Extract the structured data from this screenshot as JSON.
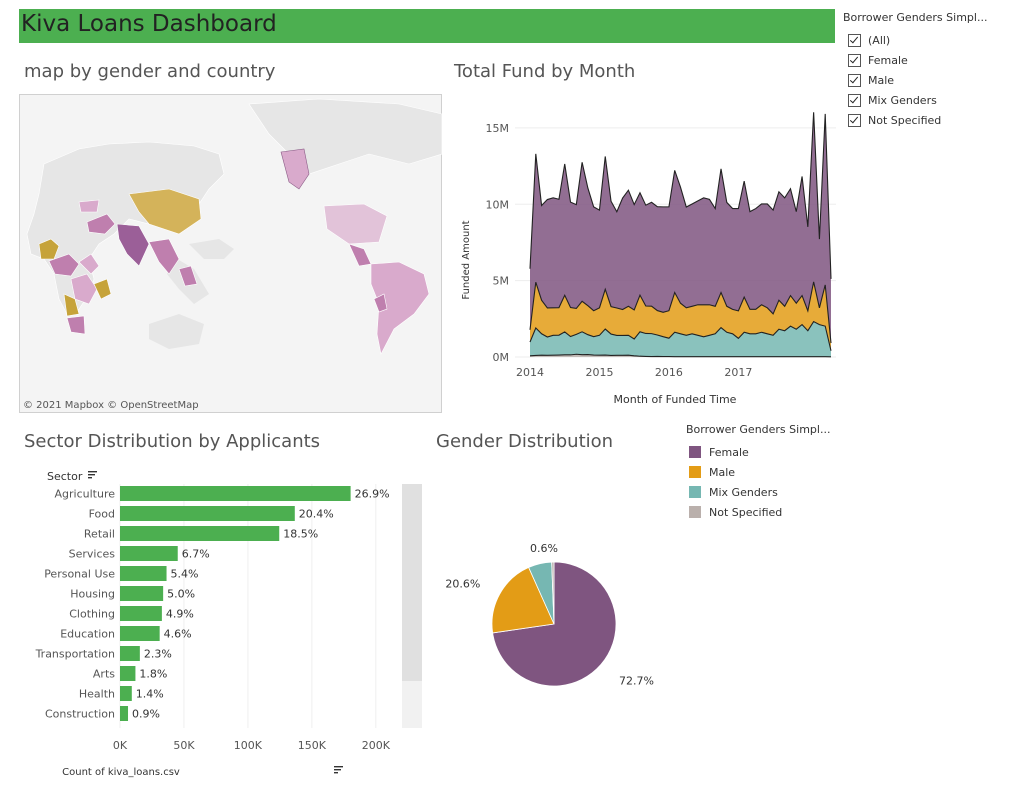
{
  "dashboard": {
    "title": "Kiva Loans Dashboard"
  },
  "colors": {
    "title_bar": "#4caf50",
    "female": "#7f5580",
    "male": "#e39c16",
    "mix": "#76b7b2",
    "not_specified": "#bab0ac",
    "bar": "#4caf50"
  },
  "map": {
    "title": "map by gender and country",
    "attribution": "© 2021 Mapbox  © OpenStreetMap"
  },
  "filter": {
    "title": "Borrower Genders Simpl...",
    "options": [
      "(All)",
      "Female",
      "Male",
      "Mix Genders",
      "Not Specified"
    ]
  },
  "legend": {
    "title": "Borrower Genders Simpl...",
    "items": [
      {
        "label": "Female",
        "color": "#7f5580"
      },
      {
        "label": "Male",
        "color": "#e39c16"
      },
      {
        "label": "Mix Genders",
        "color": "#76b7b2"
      },
      {
        "label": "Not Specified",
        "color": "#bab0ac"
      }
    ]
  },
  "chart_data": [
    {
      "type": "area",
      "title": "Total Fund by Month",
      "xlabel": "Month of Funded Time",
      "ylabel": "Funded Amount",
      "x_ticks": [
        "2014",
        "2015",
        "2016",
        "2017"
      ],
      "y_ticks": [
        "0M",
        "5M",
        "10M",
        "15M"
      ],
      "ylim": [
        0,
        16500000
      ],
      "x_start": "2014-01",
      "stacked": true,
      "series": [
        {
          "name": "Not Specified",
          "values": [
            80000,
            100000,
            120000,
            110000,
            120000,
            130000,
            140000,
            140000,
            180000,
            150000,
            160000,
            130000,
            120000,
            130000,
            100000,
            110000,
            110000,
            120000,
            80000,
            50000,
            40000,
            30000,
            40000,
            30000,
            30000,
            20000,
            20000,
            20000,
            20000,
            20000,
            20000,
            20000,
            20000,
            20000,
            20000,
            20000,
            20000,
            20000,
            20000,
            20000,
            20000,
            20000,
            20000,
            20000,
            20000,
            20000,
            20000,
            20000,
            20000,
            20000,
            20000,
            20000,
            10000
          ]
        },
        {
          "name": "Mix Genders",
          "values": [
            900000,
            1800000,
            1400000,
            1200000,
            1300000,
            1300000,
            1500000,
            1200000,
            1300000,
            1500000,
            1300000,
            1200000,
            1300000,
            1700000,
            1400000,
            1300000,
            1300000,
            1300000,
            1100000,
            1600000,
            1500000,
            1500000,
            1400000,
            1300000,
            1200000,
            1600000,
            1500000,
            1400000,
            1500000,
            1400000,
            1300000,
            1400000,
            1500000,
            1900000,
            1600000,
            1500000,
            1200000,
            1600000,
            1500000,
            1500000,
            1600000,
            1500000,
            1400000,
            1800000,
            1700000,
            2000000,
            1800000,
            2100000,
            1700000,
            2300000,
            2100000,
            2000000,
            400000
          ]
        },
        {
          "name": "Male",
          "values": [
            800000,
            3000000,
            2200000,
            1900000,
            1800000,
            1800000,
            2400000,
            1900000,
            1700000,
            2000000,
            1900000,
            1700000,
            1800000,
            2600000,
            1800000,
            1800000,
            1700000,
            1900000,
            1900000,
            2400000,
            1800000,
            1800000,
            1600000,
            1600000,
            1800000,
            2600000,
            2000000,
            1800000,
            1800000,
            2000000,
            2100000,
            2000000,
            1800000,
            2300000,
            1700000,
            1600000,
            1800000,
            2300000,
            1600000,
            1600000,
            1800000,
            1700000,
            1400000,
            1900000,
            1600000,
            2000000,
            1700000,
            1900000,
            1300000,
            2600000,
            1100000,
            2700000,
            500000
          ]
        },
        {
          "name": "Female",
          "values": [
            4000000,
            8400000,
            6200000,
            7100000,
            7200000,
            7100000,
            8600000,
            6900000,
            6800000,
            9100000,
            7700000,
            6800000,
            6400000,
            8700000,
            6900000,
            6300000,
            7300000,
            7600000,
            6900000,
            6700000,
            6600000,
            6800000,
            6800000,
            6900000,
            6800000,
            8000000,
            7600000,
            6600000,
            6700000,
            6800000,
            7000000,
            6900000,
            6400000,
            8100000,
            6800000,
            6600000,
            6700000,
            7600000,
            6400000,
            6600000,
            6600000,
            6800000,
            6800000,
            7100000,
            7100000,
            7000000,
            6000000,
            7800000,
            5500000,
            11100000,
            4500000,
            11200000,
            4200000
          ]
        }
      ]
    },
    {
      "type": "bar",
      "title": "Sector Distribution by Applicants",
      "category_header": "Sector",
      "xlabel": "Count of kiva_loans.csv",
      "x_ticks": [
        "0K",
        "50K",
        "100K",
        "150K",
        "200K"
      ],
      "xlim": [
        0,
        215000
      ],
      "categories": [
        "Agriculture",
        "Food",
        "Retail",
        "Services",
        "Personal Use",
        "Housing",
        "Clothing",
        "Education",
        "Transportation",
        "Arts",
        "Health",
        "Construction"
      ],
      "values": [
        180302,
        136657,
        124494,
        45140,
        36385,
        33731,
        32742,
        31013,
        15518,
        12060,
        9223,
        6268
      ],
      "labels": [
        "26.9%",
        "20.4%",
        "18.5%",
        "6.7%",
        "5.4%",
        "5.0%",
        "4.9%",
        "4.6%",
        "2.3%",
        "1.8%",
        "1.4%",
        "0.9%"
      ]
    },
    {
      "type": "pie",
      "title": "Gender Distribution",
      "slices": [
        {
          "name": "Female",
          "value": 72.7,
          "label": "72.7%"
        },
        {
          "name": "Male",
          "value": 20.6,
          "label": "20.6%"
        },
        {
          "name": "Mix Genders",
          "value": 6.1,
          "label": ""
        },
        {
          "name": "Not Specified",
          "value": 0.6,
          "label": "0.6%"
        }
      ]
    }
  ]
}
